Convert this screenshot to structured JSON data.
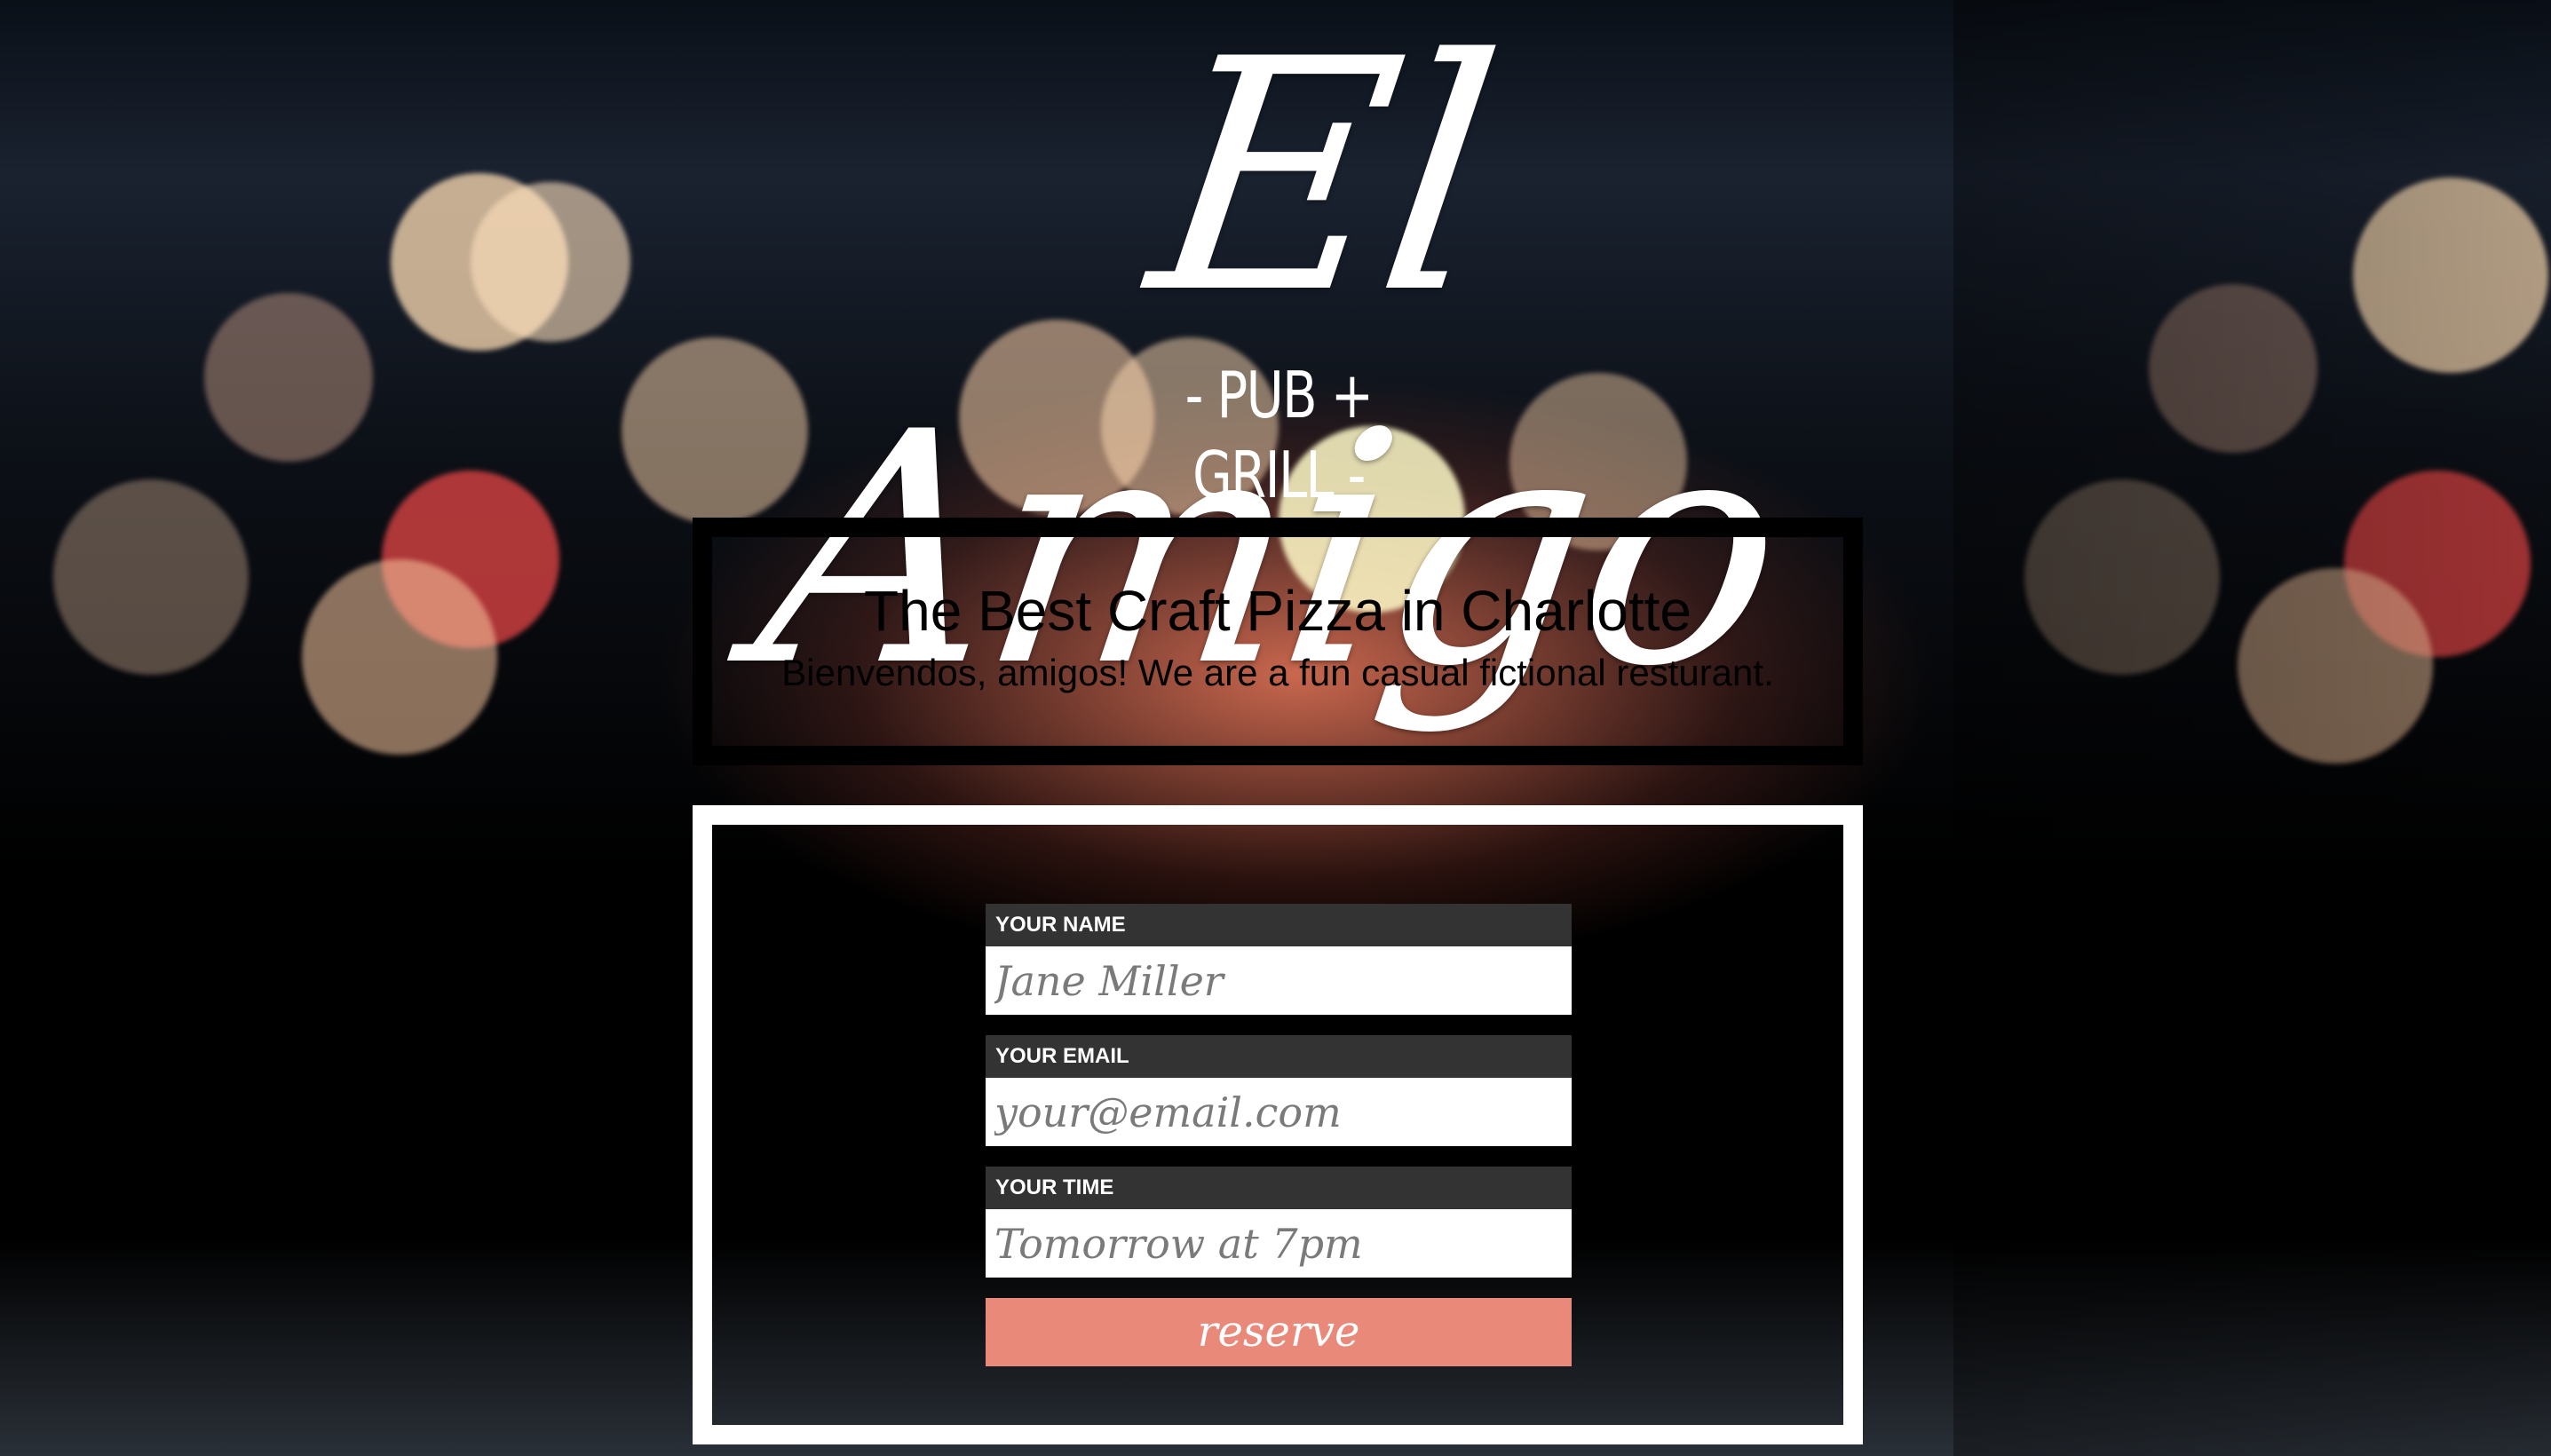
{
  "logo": {
    "script_text": "El Amigo",
    "subtitle": "- PUB + GRILL -"
  },
  "intro": {
    "title": "The Best Craft Pizza in Charlotte",
    "text": "Bienvendos, amigos! We are a fun casual fictional resturant."
  },
  "form": {
    "fields": [
      {
        "label": "YOUR NAME",
        "placeholder": "Jane Miller"
      },
      {
        "label": "YOUR EMAIL",
        "placeholder": "your@email.com"
      },
      {
        "label": "YOUR TIME",
        "placeholder": "Tomorrow at 7pm"
      }
    ],
    "submit_label": "reserve"
  },
  "colors": {
    "label_bg": "#333333",
    "button_bg": "#e8897a",
    "intro_border": "#000000",
    "form_border": "#ffffff"
  }
}
